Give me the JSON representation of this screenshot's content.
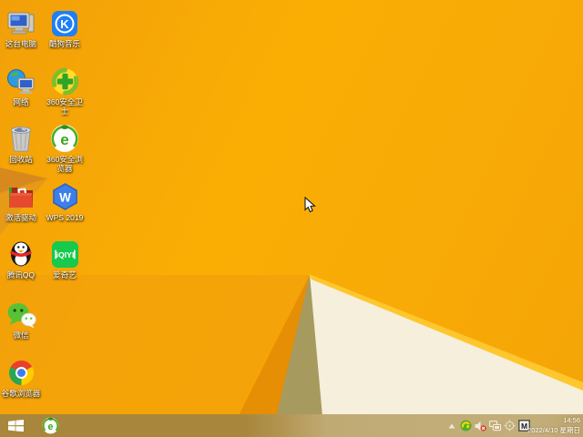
{
  "desktop": {
    "icons": [
      {
        "name": "this-pc",
        "label": "这台电脑"
      },
      {
        "name": "kugou-music",
        "label": "酷狗音乐"
      },
      {
        "name": "network",
        "label": "网络"
      },
      {
        "name": "360-safety-guard",
        "label": "360安全卫士"
      },
      {
        "name": "recycle-bin",
        "label": "回收站"
      },
      {
        "name": "360-safe-browser",
        "label": "360安全浏览器"
      },
      {
        "name": "activate-driver",
        "label": "激活驱动"
      },
      {
        "name": "wps-2019",
        "label": "WPS 2019"
      },
      {
        "name": "tencent-qq",
        "label": "腾讯QQ"
      },
      {
        "name": "iqiyi",
        "label": "爱奇艺"
      },
      {
        "name": "wechat",
        "label": "微信"
      },
      {
        "name": "google-chrome",
        "label": "谷歌浏览器"
      }
    ],
    "wallpaper_colors": {
      "base": "#F8A906",
      "facet_dark": "#D8891E",
      "facet_mid": "#E69A16",
      "olive_wedge": "#A79A5F",
      "cream_facet": "#F5EFDC",
      "edge_highlight": "#FFC72E"
    }
  },
  "taskbar": {
    "colors": {
      "left": "#A8873C",
      "right": "#C3AE7B"
    },
    "start_button": {
      "icon": "windows-logo"
    },
    "pinned": [
      {
        "name": "360-safe-browser",
        "label": "360安全浏览器"
      }
    ],
    "tray": {
      "icons": [
        "show-hidden-icons",
        "360-security",
        "volume-muted",
        "network-status",
        "crosshair-utility",
        "input-method"
      ],
      "input_indicator": "M",
      "time": "14:56",
      "date": "2022/4/10 星期日"
    }
  }
}
